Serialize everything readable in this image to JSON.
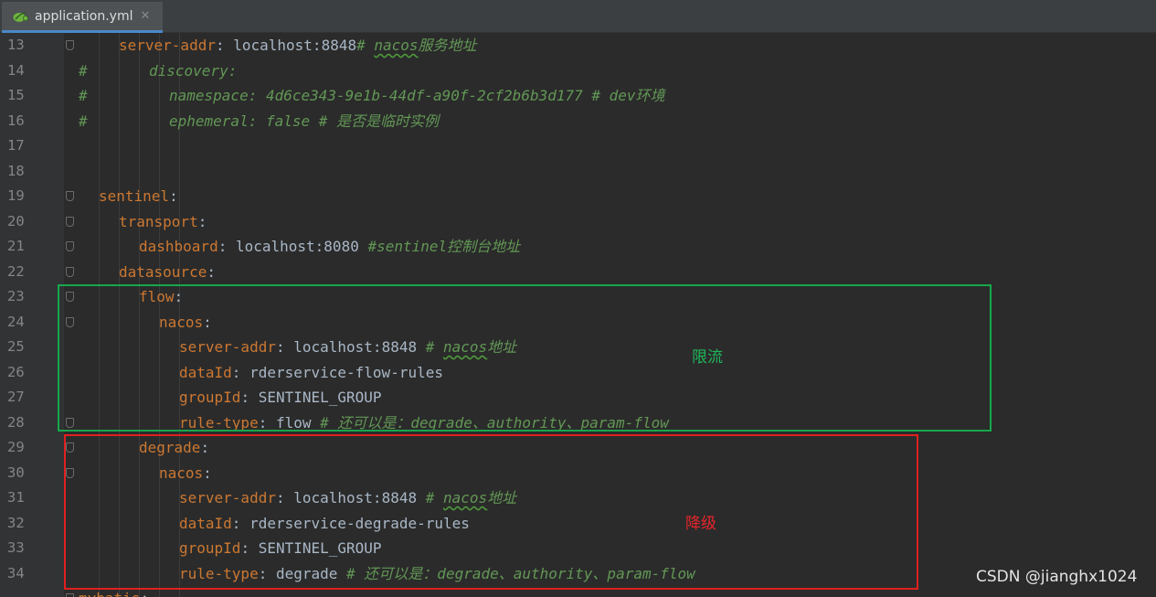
{
  "tab": {
    "label": "application.yml",
    "close": "✕",
    "icon": "spring-leaf-icon"
  },
  "lines": [
    {
      "num": "13",
      "fold": true,
      "hash": "",
      "indent": 2,
      "key": "server-addr",
      "sep": ": ",
      "value": "localhost:8848",
      "comment": "# nacos服务地址",
      "comment_parts": [
        "# ",
        "nacos",
        "服务地址"
      ]
    },
    {
      "num": "14",
      "fold": false,
      "hash": "#",
      "indent": 2,
      "comment_only": "discovery:"
    },
    {
      "num": "15",
      "fold": false,
      "hash": "#",
      "indent": 3,
      "comment_only": "namespace: 4d6ce343-9e1b-44df-a90f-2cf2b6b3d177 # dev环境"
    },
    {
      "num": "16",
      "fold": false,
      "hash": "#",
      "indent": 3,
      "comment_only": "ephemeral: false # 是否是临时实例"
    },
    {
      "num": "17"
    },
    {
      "num": "18"
    },
    {
      "num": "19",
      "fold": true,
      "indent": 1,
      "key": "sentinel",
      "sep": ":"
    },
    {
      "num": "20",
      "fold": true,
      "indent": 2,
      "key": "transport",
      "sep": ":"
    },
    {
      "num": "21",
      "fold": true,
      "indent": 3,
      "key": "dashboard",
      "sep": ": ",
      "value": "localhost:8080",
      "comment": " #sentinel控制台地址"
    },
    {
      "num": "22",
      "fold": true,
      "indent": 2,
      "key": "datasource",
      "sep": ":"
    },
    {
      "num": "23",
      "fold": true,
      "indent": 3,
      "key": "flow",
      "sep": ":"
    },
    {
      "num": "24",
      "fold": true,
      "indent": 4,
      "key": "nacos",
      "sep": ":"
    },
    {
      "num": "25",
      "fold": false,
      "indent": 5,
      "key": "server-addr",
      "sep": ": ",
      "value": "localhost:8848",
      "comment_parts": [
        " # ",
        "nacos",
        "地址"
      ]
    },
    {
      "num": "26",
      "fold": false,
      "indent": 5,
      "key": "dataId",
      "sep": ": ",
      "value": "rderservice-flow-rules"
    },
    {
      "num": "27",
      "fold": false,
      "indent": 5,
      "key": "groupId",
      "sep": ": ",
      "value": "SENTINEL_GROUP"
    },
    {
      "num": "28",
      "fold": true,
      "indent": 5,
      "key": "rule-type",
      "sep": ": ",
      "value": "flow",
      "comment": " # 还可以是：degrade、authority、param-flow"
    },
    {
      "num": "29",
      "fold": true,
      "indent": 3,
      "key": "degrade",
      "sep": ":"
    },
    {
      "num": "30",
      "fold": true,
      "indent": 4,
      "key": "nacos",
      "sep": ":"
    },
    {
      "num": "31",
      "fold": false,
      "indent": 5,
      "key": "server-addr",
      "sep": ": ",
      "value": "localhost:8848",
      "comment_parts": [
        " # ",
        "nacos",
        "地址"
      ]
    },
    {
      "num": "32",
      "fold": false,
      "indent": 5,
      "key": "dataId",
      "sep": ": ",
      "value": "rderservice-degrade-rules"
    },
    {
      "num": "33",
      "fold": false,
      "indent": 5,
      "key": "groupId",
      "sep": ": ",
      "value": "SENTINEL_GROUP"
    },
    {
      "num": "34",
      "fold": false,
      "indent": 5,
      "key": "rule-type",
      "sep": ": ",
      "value": "degrade",
      "comment": " # 还可以是：degrade、authority、param-flow"
    },
    {
      "num": "",
      "fold": true,
      "indent": 0,
      "key": "mybatis",
      "sep": ":"
    }
  ],
  "annotations": {
    "flow_label": "限流",
    "degrade_label": "降级"
  },
  "watermark": "CSDN @jianghx1024",
  "colors": {
    "key": "#cc7832",
    "value": "#a9b7c6",
    "comment": "#629755",
    "green_box": "#16a84a",
    "red_box": "#e02020",
    "background": "#2b2b2b"
  }
}
